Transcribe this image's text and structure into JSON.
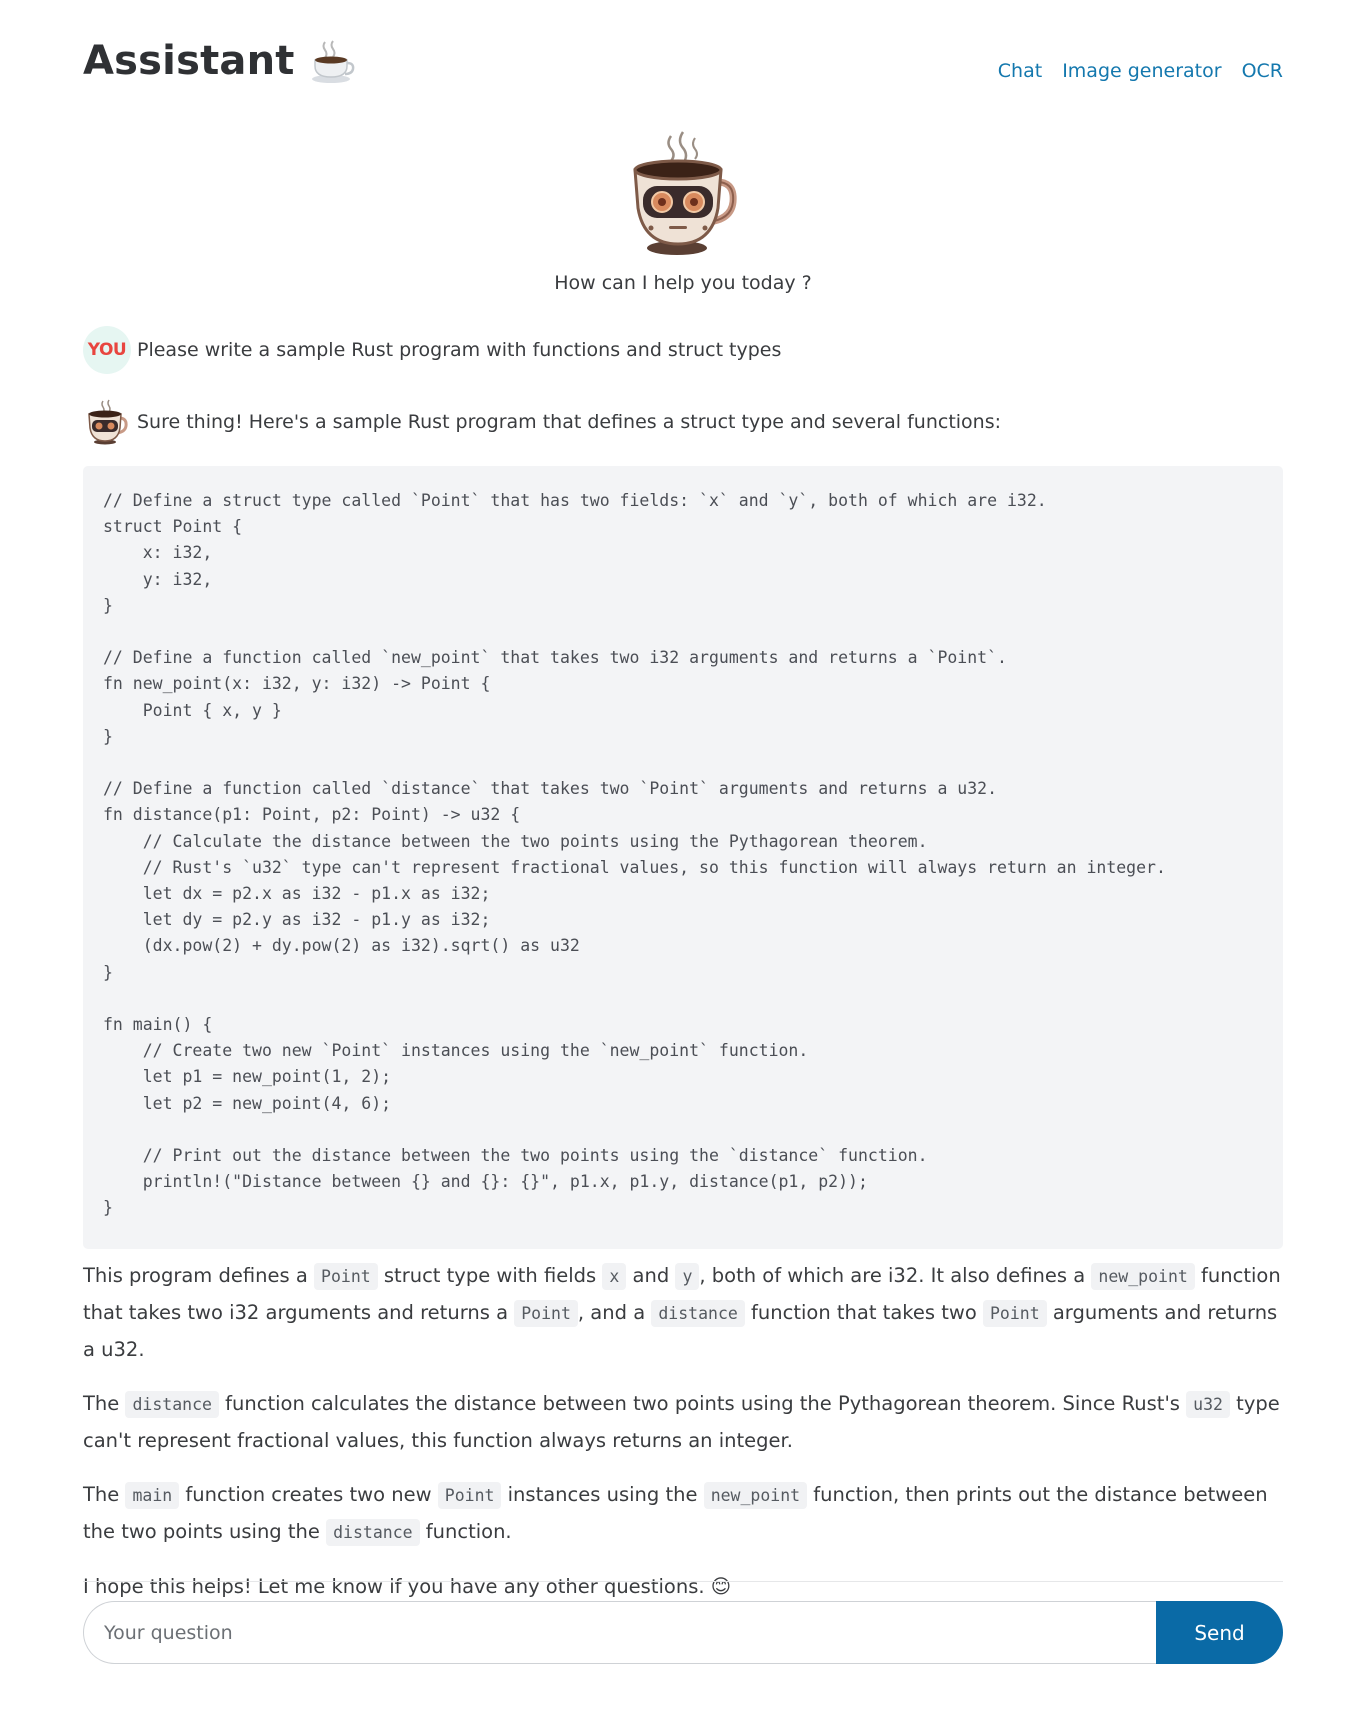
{
  "header": {
    "brand": "Assistant",
    "brand_emoji": "☕",
    "nav": [
      {
        "label": "Chat"
      },
      {
        "label": "Image generator"
      },
      {
        "label": "OCR"
      }
    ]
  },
  "hero": {
    "logo_icon": "robot-coffee-cup-icon",
    "greeting": "How can I help you today ?"
  },
  "conversation": {
    "user": {
      "avatar_label": "YOU",
      "text": "Please write a sample Rust program with functions and struct types"
    },
    "assistant": {
      "avatar_icon": "robot-coffee-cup-icon",
      "intro": "Sure thing! Here's a sample Rust program that defines a struct type and several functions:",
      "code": "// Define a struct type called `Point` that has two fields: `x` and `y`, both of which are i32.\nstruct Point {\n    x: i32,\n    y: i32,\n}\n\n// Define a function called `new_point` that takes two i32 arguments and returns a `Point`.\nfn new_point(x: i32, y: i32) -> Point {\n    Point { x, y }\n}\n\n// Define a function called `distance` that takes two `Point` arguments and returns a u32.\nfn distance(p1: Point, p2: Point) -> u32 {\n    // Calculate the distance between the two points using the Pythagorean theorem.\n    // Rust's `u32` type can't represent fractional values, so this function will always return an integer.\n    let dx = p2.x as i32 - p1.x as i32;\n    let dy = p2.y as i32 - p1.y as i32;\n    (dx.pow(2) + dy.pow(2) as i32).sqrt() as u32\n}\n\nfn main() {\n    // Create two new `Point` instances using the `new_point` function.\n    let p1 = new_point(1, 2);\n    let p2 = new_point(4, 6);\n\n    // Print out the distance between the two points using the `distance` function.\n    println!(\"Distance between {} and {}: {}\", p1.x, p1.y, distance(p1, p2));\n}",
      "p1": {
        "t1": "This program defines a ",
        "c1": "Point",
        "t2": " struct type with fields ",
        "c2": "x",
        "t3": " and ",
        "c3": "y",
        "t4": ", both of which are i32. It also defines a ",
        "c4": "new_point",
        "t5": " function that takes two i32 arguments and returns a ",
        "c5": "Point",
        "t6": ", and a ",
        "c6": "distance",
        "t7": " function that takes two ",
        "c7": "Point",
        "t8": " arguments and returns a u32."
      },
      "p2": {
        "t1": "The ",
        "c1": "distance",
        "t2": " function calculates the distance between two points using the Pythagorean theorem. Since Rust's ",
        "c2": "u32",
        "t3": " type can't represent fractional values, this function always returns an integer."
      },
      "p3": {
        "t1": "The ",
        "c1": "main",
        "t2": " function creates two new ",
        "c2": "Point",
        "t3": " instances using the ",
        "c3": "new_point",
        "t4": " function, then prints out the distance between the two points using the ",
        "c4": "distance",
        "t5": " function."
      },
      "p4": {
        "text": "I hope this helps! Let me know if you have any other questions. 😊"
      }
    }
  },
  "input": {
    "placeholder": "Your question",
    "value": "",
    "send_label": "Send"
  },
  "colors": {
    "link": "#1478ae",
    "send_button": "#0a6aa6",
    "code_background": "#f3f4f6"
  }
}
